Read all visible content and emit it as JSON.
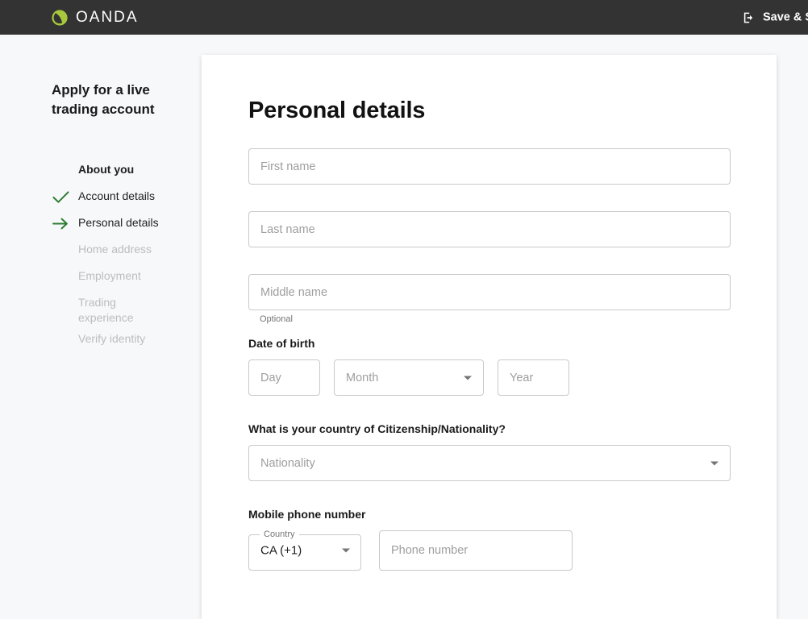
{
  "header": {
    "brand_name": "OANDA",
    "brand_icon": "oanda-logo-icon",
    "save_exit_label": "Save & Si",
    "save_exit_icon": "exit-icon",
    "background": "#333333"
  },
  "sidebar": {
    "title": "Apply for a live trading account",
    "accent_color": "#2e7d32",
    "steps": [
      {
        "label": "About you",
        "state": "header",
        "icon": ""
      },
      {
        "label": "Account details",
        "state": "done",
        "icon": "check-icon"
      },
      {
        "label": "Personal details",
        "state": "current",
        "icon": "arrow-right-icon"
      },
      {
        "label": "Home address",
        "state": "disabled",
        "icon": ""
      },
      {
        "label": "Employment",
        "state": "disabled",
        "icon": ""
      },
      {
        "label": "Trading experience",
        "state": "disabled",
        "icon": ""
      },
      {
        "label": "Verify identity",
        "state": "disabled",
        "icon": ""
      }
    ]
  },
  "main": {
    "page_title": "Personal details",
    "first_name": {
      "placeholder": "First name",
      "value": ""
    },
    "last_name": {
      "placeholder": "Last name",
      "value": ""
    },
    "middle_name": {
      "placeholder": "Middle name",
      "value": "",
      "helper": "Optional"
    },
    "date_of_birth": {
      "label": "Date of birth",
      "day": {
        "placeholder": "Day",
        "value": ""
      },
      "month": {
        "placeholder": "Month",
        "value": "",
        "icon": "chevron-down-icon"
      },
      "year": {
        "placeholder": "Year",
        "value": ""
      }
    },
    "citizenship": {
      "label": "What is your country of Citizenship/Nationality?",
      "placeholder": "Nationality",
      "value": "",
      "icon": "chevron-down-icon"
    },
    "mobile_phone": {
      "label": "Mobile phone number",
      "country": {
        "label": "Country",
        "value": "CA (+1)",
        "icon": "chevron-down-icon"
      },
      "number": {
        "placeholder": "Phone number",
        "value": ""
      }
    }
  }
}
